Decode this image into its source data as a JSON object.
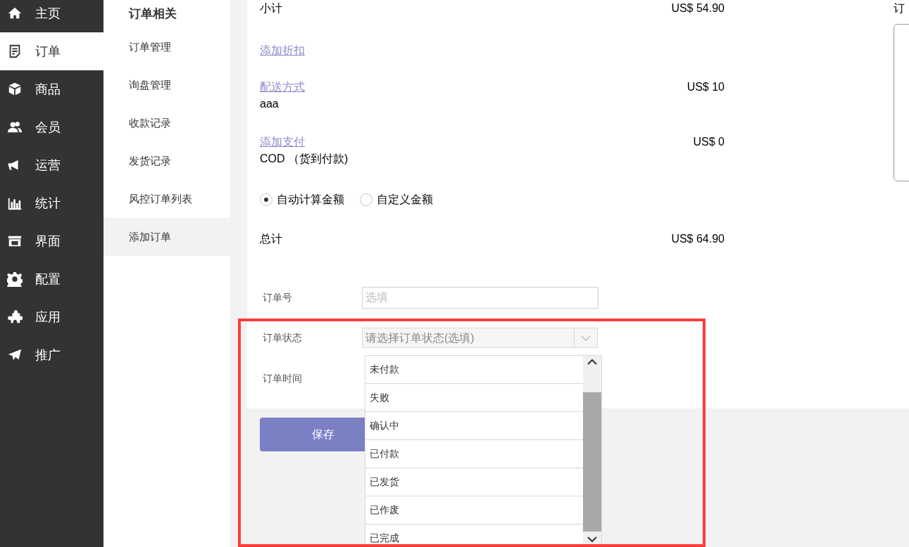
{
  "nav": {
    "items": [
      {
        "label": "主页",
        "selected": false
      },
      {
        "label": "订单",
        "selected": true
      },
      {
        "label": "商品",
        "selected": false
      },
      {
        "label": "会员",
        "selected": false
      },
      {
        "label": "运营",
        "selected": false
      },
      {
        "label": "统计",
        "selected": false
      },
      {
        "label": "界面",
        "selected": false
      },
      {
        "label": "配置",
        "selected": false
      },
      {
        "label": "应用",
        "selected": false
      },
      {
        "label": "推广",
        "selected": false
      }
    ]
  },
  "subnav": {
    "title": "订单相关",
    "items": [
      {
        "label": "订单管理",
        "selected": false
      },
      {
        "label": "询盘管理",
        "selected": false
      },
      {
        "label": "收款记录",
        "selected": false
      },
      {
        "label": "发货记录",
        "selected": false
      },
      {
        "label": "风控订单列表",
        "selected": false
      },
      {
        "label": "添加订单",
        "selected": true
      }
    ]
  },
  "summary": {
    "subtotal": {
      "label": "小计",
      "amount": "US$ 54.90"
    },
    "discount": {
      "link": "添加折扣"
    },
    "shipping": {
      "link": "配送方式",
      "method": "aaa",
      "amount": "US$ 10"
    },
    "payment": {
      "link": "添加支付",
      "method": "COD （货到付款)",
      "amount": "US$ 0"
    },
    "amount_mode": [
      {
        "label": "自动计算金额",
        "selected": true
      },
      {
        "label": "自定义金额",
        "selected": false
      }
    ],
    "total": {
      "label": "总计",
      "amount": "US$ 64.90"
    }
  },
  "right_panel": {
    "title": "订"
  },
  "form": {
    "order_no": {
      "label": "订单号",
      "placeholder": "选填"
    },
    "status": {
      "label": "订单状态",
      "placeholder": "请选择订单状态(选填)",
      "expanded": true,
      "highlighted": true,
      "options": [
        "未付款",
        "失败",
        "确认中",
        "已付款",
        "已发货",
        "已作废",
        "已完成"
      ]
    },
    "time": {
      "label": "订单时间"
    }
  },
  "save_button": "保存"
}
